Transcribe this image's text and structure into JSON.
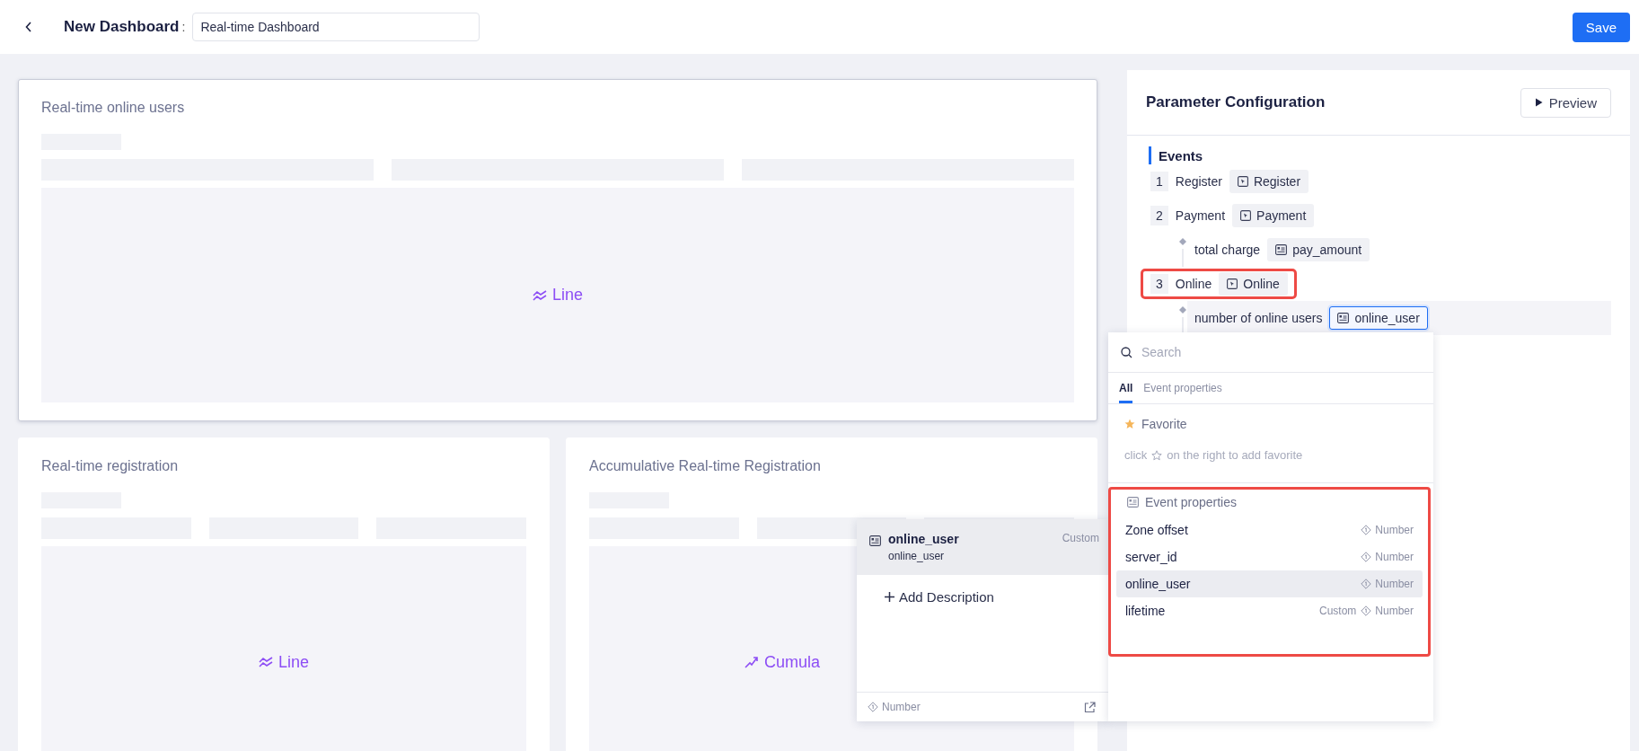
{
  "header": {
    "title": "New Dashboard",
    "separator": ":",
    "name_value": "Real-time Dashboard",
    "save": "Save"
  },
  "cards": [
    {
      "title": "Real-time online users",
      "selected": true,
      "kind": "line",
      "chart_label": "Line"
    },
    {
      "title": "Real-time registration",
      "selected": false,
      "kind": "line",
      "chart_label": "Line"
    },
    {
      "title": "Accumulative Real-time Registration",
      "selected": false,
      "kind": "cumulative",
      "chart_label": "Cumula"
    }
  ],
  "config": {
    "title": "Parameter Configuration",
    "preview": "Preview",
    "section": "Events",
    "events": [
      {
        "index": "1",
        "name": "Register",
        "event": "Register",
        "highlighted": false
      },
      {
        "index": "2",
        "name": "Payment",
        "event": "Payment",
        "highlighted": false,
        "properties": [
          {
            "label": "total charge",
            "field": "pay_amount",
            "active": false
          }
        ]
      },
      {
        "index": "3",
        "name": "Online",
        "event": "Online",
        "highlighted": true,
        "properties": [
          {
            "label": "number of online users",
            "field": "online_user",
            "active": true
          }
        ]
      }
    ]
  },
  "picker": {
    "search_placeholder": "Search",
    "tabs": [
      {
        "label": "All",
        "selected": true
      },
      {
        "label": "Event properties",
        "selected": false
      }
    ],
    "favorite": {
      "title": "Favorite",
      "hint_before": "click",
      "hint_after": "on the right to add favorite"
    },
    "properties": {
      "title": "Event properties",
      "highlighted": true,
      "items": [
        {
          "name": "Zone offset",
          "type": "Number",
          "selected": false
        },
        {
          "name": "server_id",
          "type": "Number",
          "selected": false
        },
        {
          "name": "online_user",
          "type": "Number",
          "selected": true
        },
        {
          "name": "lifetime",
          "tag": "Custom",
          "type": "Number",
          "selected": false
        }
      ]
    }
  },
  "detail": {
    "name": "online_user",
    "key": "online_user",
    "tag": "Custom",
    "add": "Add Description",
    "type": "Number"
  }
}
